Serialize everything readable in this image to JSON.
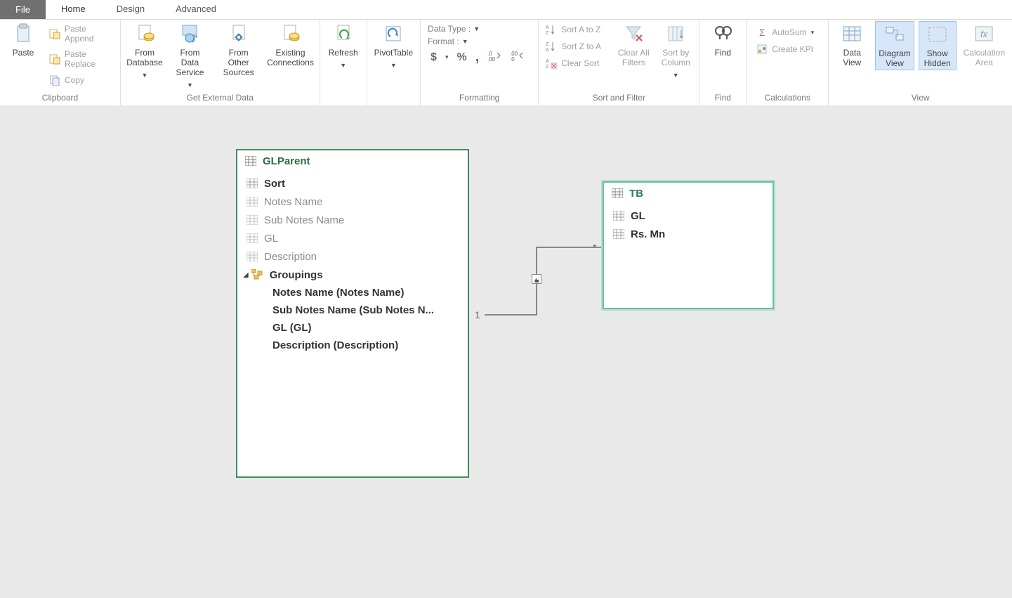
{
  "tabs": {
    "file": "File",
    "home": "Home",
    "design": "Design",
    "advanced": "Advanced"
  },
  "ribbon": {
    "clipboard": {
      "group_label": "Clipboard",
      "paste": "Paste",
      "paste_append": "Paste Append",
      "paste_replace": "Paste Replace",
      "copy": "Copy"
    },
    "external": {
      "group_label": "Get External Data",
      "from_db": "From\nDatabase",
      "from_svc": "From Data\nService",
      "from_other": "From Other\nSources",
      "existing": "Existing\nConnections",
      "refresh": "Refresh",
      "pivot": "PivotTable"
    },
    "formatting": {
      "group_label": "Formatting",
      "data_type": "Data Type :",
      "format": "Format :",
      "currency": "$",
      "percent": "%",
      "comma": ",",
      "inc": ".00",
      "dec": ".00"
    },
    "sortfilter": {
      "group_label": "Sort and Filter",
      "atoz": "Sort A to Z",
      "ztoa": "Sort Z to A",
      "clear_sort": "Clear Sort",
      "clear_filters": "Clear All\nFilters",
      "sort_by_col": "Sort by\nColumn"
    },
    "find": {
      "group_label": "Find",
      "find": "Find"
    },
    "calc": {
      "group_label": "Calculations",
      "autosum": "AutoSum",
      "kpi": "Create KPI"
    },
    "view": {
      "group_label": "View",
      "data_view": "Data\nView",
      "diagram": "Diagram\nView",
      "show_hidden": "Show\nHidden",
      "calc_area": "Calculation\nArea"
    }
  },
  "diagram": {
    "tables": [
      {
        "name": "GLParent",
        "fields": [
          "Sort",
          "Notes Name",
          "Sub Notes Name",
          "GL",
          "Description"
        ],
        "hierarchy": {
          "name": "Groupings",
          "levels": [
            "Notes Name (Notes Name)",
            "Sub Notes Name (Sub Notes N...",
            "GL (GL)",
            "Description (Description)"
          ]
        }
      },
      {
        "name": "TB",
        "fields": [
          "GL",
          "Rs. Mn"
        ]
      }
    ],
    "relationship": {
      "from": "GLParent",
      "to": "TB",
      "from_card": "1",
      "to_card": "*"
    }
  }
}
